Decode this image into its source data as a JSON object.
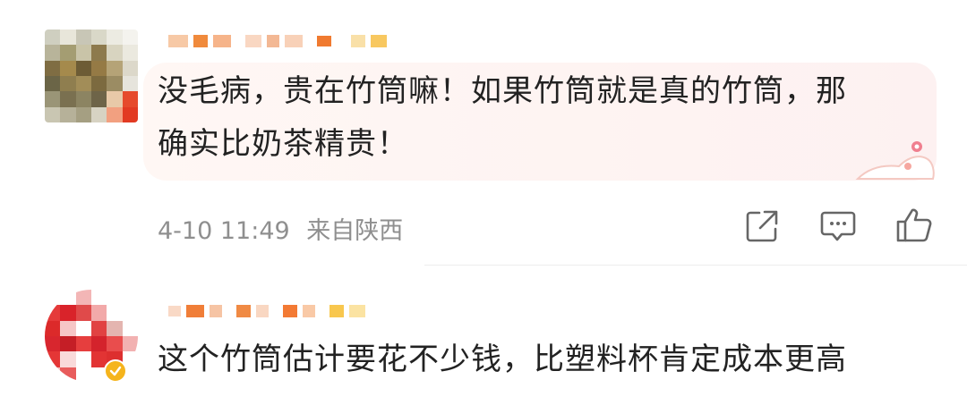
{
  "comments": [
    {
      "text_line1": "没毛病，贵在竹筒嘛！如果竹筒就是真的竹筒，那",
      "text_line2": "确实比奶茶精贵！",
      "timestamp": "4-10 11:49",
      "location": "来自陕西",
      "icons": [
        "share-icon",
        "comment-icon",
        "like-icon"
      ],
      "username_blurred": true
    },
    {
      "text_line1": "这个竹筒估计要花不少钱，比塑料杯肯定成本更高",
      "username_blurred": true,
      "verified": true
    }
  ],
  "colors": {
    "text": "#222222",
    "meta": "#8f8f8f",
    "icon": "#666666",
    "bubble": "#fdf3f1",
    "badge": "#f5b41c"
  }
}
